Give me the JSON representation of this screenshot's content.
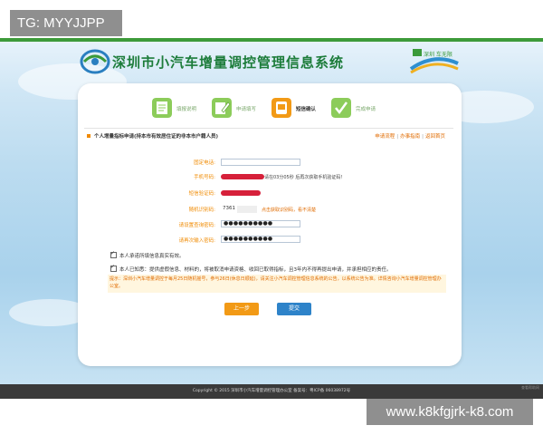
{
  "overlay": {
    "tag_badge": "TG: MYYJJPP",
    "watermark": "www.k8kfgjrk-k8.com"
  },
  "header": {
    "title": "深圳市小汽车增量调控管理信息系统",
    "right_logo_text": "深圳 车无限"
  },
  "steps": [
    {
      "label": "填报说明",
      "active": false
    },
    {
      "label": "申请填写",
      "active": false
    },
    {
      "label": "短信确认",
      "active": true
    },
    {
      "label": "完成申请",
      "active": false
    }
  ],
  "section": {
    "title": "个人增量指标申请(持本市有效居住证的非本市户籍人员)",
    "links": [
      "申请流程",
      "办事指南",
      "返回首页"
    ]
  },
  "form": {
    "rows": [
      {
        "label": "固定电话:"
      },
      {
        "label": "手机号码:",
        "hint": "请在03分05秒 后再次获取手机验证码！"
      },
      {
        "label": "短信验证码:"
      },
      {
        "label": "随机识别码:",
        "value": "7361",
        "link": "点击获取识别码，看不清楚"
      },
      {
        "label": "请设置查询密码:",
        "masked": "●●●●●●●●●●"
      },
      {
        "label": "请再次输入密码:",
        "masked": "●●●●●●●●●●"
      }
    ]
  },
  "checks": [
    {
      "text": "本人承诺所填信息真实有效。",
      "checked": true
    },
    {
      "text": "本人已知悉：提供虚假信息、材料的，将被取消申请资格、收回已取得指标，且3年内不得再提出申请，并承担相应的责任。",
      "checked": true
    }
  ],
  "notice": "提示：深圳小汽车增量调控于每月25日随机摇号，参与26日(休息日顺延)，请关注小汽车调控管理信息系统的公告，以系统公告为准。详情咨询小汽车增量调控管理办公室。",
  "buttons": {
    "prev": "上一步",
    "submit": "提交"
  },
  "footer": {
    "text": "Copyright © 2015 深圳市小汽车增量调控管理办公室  备案号：粤ICP备 06038972号",
    "corner": "查看帮助网"
  },
  "colors": {
    "brand_green": "#1c7c3a",
    "accent_orange": "#f08a00",
    "button_blue": "#2e83c9",
    "redaction": "#d6203a"
  }
}
